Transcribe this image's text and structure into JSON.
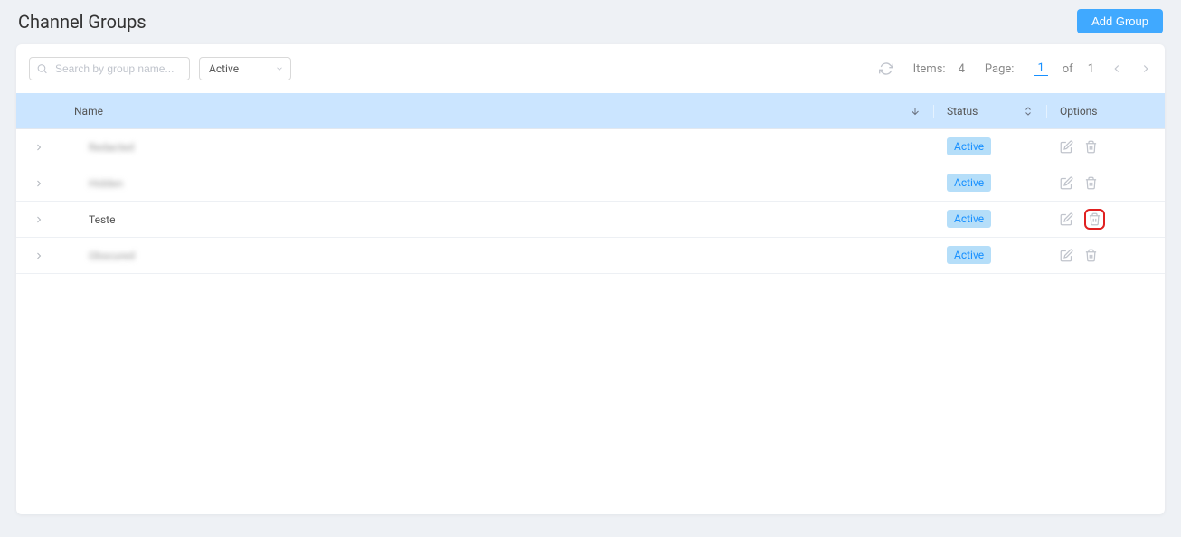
{
  "header": {
    "title": "Channel Groups",
    "add_button": "Add Group"
  },
  "toolbar": {
    "search_placeholder": "Search by group name...",
    "filter_value": "Active",
    "items_label": "Items:",
    "items_count": "4",
    "page_label": "Page:",
    "page_current": "1",
    "of_label": "of",
    "page_total": "1"
  },
  "table": {
    "headers": {
      "name": "Name",
      "status": "Status",
      "options": "Options"
    },
    "rows": [
      {
        "name": "Redacted",
        "status": "Active",
        "blurred": true,
        "highlight_delete": false
      },
      {
        "name": "Hidden",
        "status": "Active",
        "blurred": true,
        "highlight_delete": false
      },
      {
        "name": "Teste",
        "status": "Active",
        "blurred": false,
        "highlight_delete": true
      },
      {
        "name": "Obscured",
        "status": "Active",
        "blurred": true,
        "highlight_delete": false
      }
    ]
  }
}
